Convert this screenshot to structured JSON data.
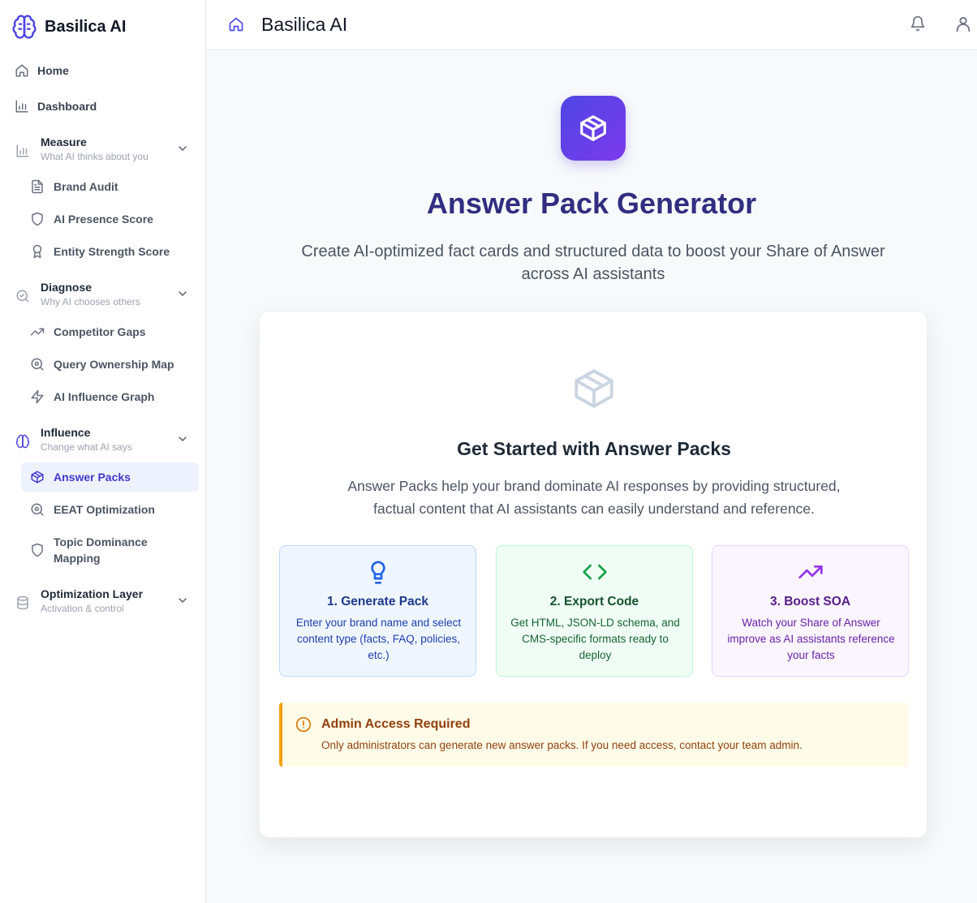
{
  "brand": {
    "name": "Basilica AI"
  },
  "sidebar": {
    "top_items": [
      {
        "label": "Home",
        "icon": "home-icon"
      },
      {
        "label": "Dashboard",
        "icon": "bar-chart-icon"
      }
    ],
    "groups": [
      {
        "title": "Measure",
        "subtitle": "What AI thinks about you",
        "icon": "bar-chart-icon",
        "items": [
          {
            "label": "Brand Audit",
            "icon": "file-text-icon"
          },
          {
            "label": "AI Presence Score",
            "icon": "shield-icon"
          },
          {
            "label": "Entity Strength Score",
            "icon": "award-icon"
          }
        ]
      },
      {
        "title": "Diagnose",
        "subtitle": "Why AI chooses others",
        "icon": "search-check-icon",
        "items": [
          {
            "label": "Competitor Gaps",
            "icon": "trending-up-icon"
          },
          {
            "label": "Query Ownership Map",
            "icon": "search-icon"
          },
          {
            "label": "AI Influence Graph",
            "icon": "zap-icon"
          }
        ]
      },
      {
        "title": "Influence",
        "subtitle": "Change what AI says",
        "icon": "brain-icon",
        "items": [
          {
            "label": "Answer Packs",
            "icon": "package-icon",
            "active": true
          },
          {
            "label": "EEAT Optimization",
            "icon": "search-icon"
          },
          {
            "label": "Topic Dominance Mapping",
            "icon": "shield-icon"
          }
        ]
      },
      {
        "title": "Optimization Layer",
        "subtitle": "Activation & control",
        "icon": "database-icon",
        "items": []
      }
    ]
  },
  "header": {
    "title": "Basilica AI"
  },
  "main": {
    "title": "Answer Pack Generator",
    "subtitle": "Create AI-optimized fact cards and structured data to boost your Share of Answer across AI assistants",
    "card": {
      "title": "Get Started with Answer Packs",
      "description": "Answer Packs help your brand dominate AI responses by providing structured, factual content that AI assistants can easily understand and reference.",
      "steps": [
        {
          "title": "1. Generate Pack",
          "description": "Enter your brand name and select content type (facts, FAQ, policies, etc.)",
          "icon": "lightbulb-icon"
        },
        {
          "title": "2. Export Code",
          "description": "Get HTML, JSON-LD schema, and CMS-specific formats ready to deploy",
          "icon": "code-icon"
        },
        {
          "title": "3. Boost SOA",
          "description": "Watch your Share of Answer improve as AI assistants reference your facts",
          "icon": "trending-up-icon"
        }
      ],
      "alert": {
        "title": "Admin Access Required",
        "text": "Only administrators can generate new answer packs. If you need access, contact your team admin.",
        "icon": "alert-circle-icon"
      }
    }
  },
  "colors": {
    "accent": "#4f46e5",
    "title": "#312e81",
    "warning": "#f59e0b"
  }
}
